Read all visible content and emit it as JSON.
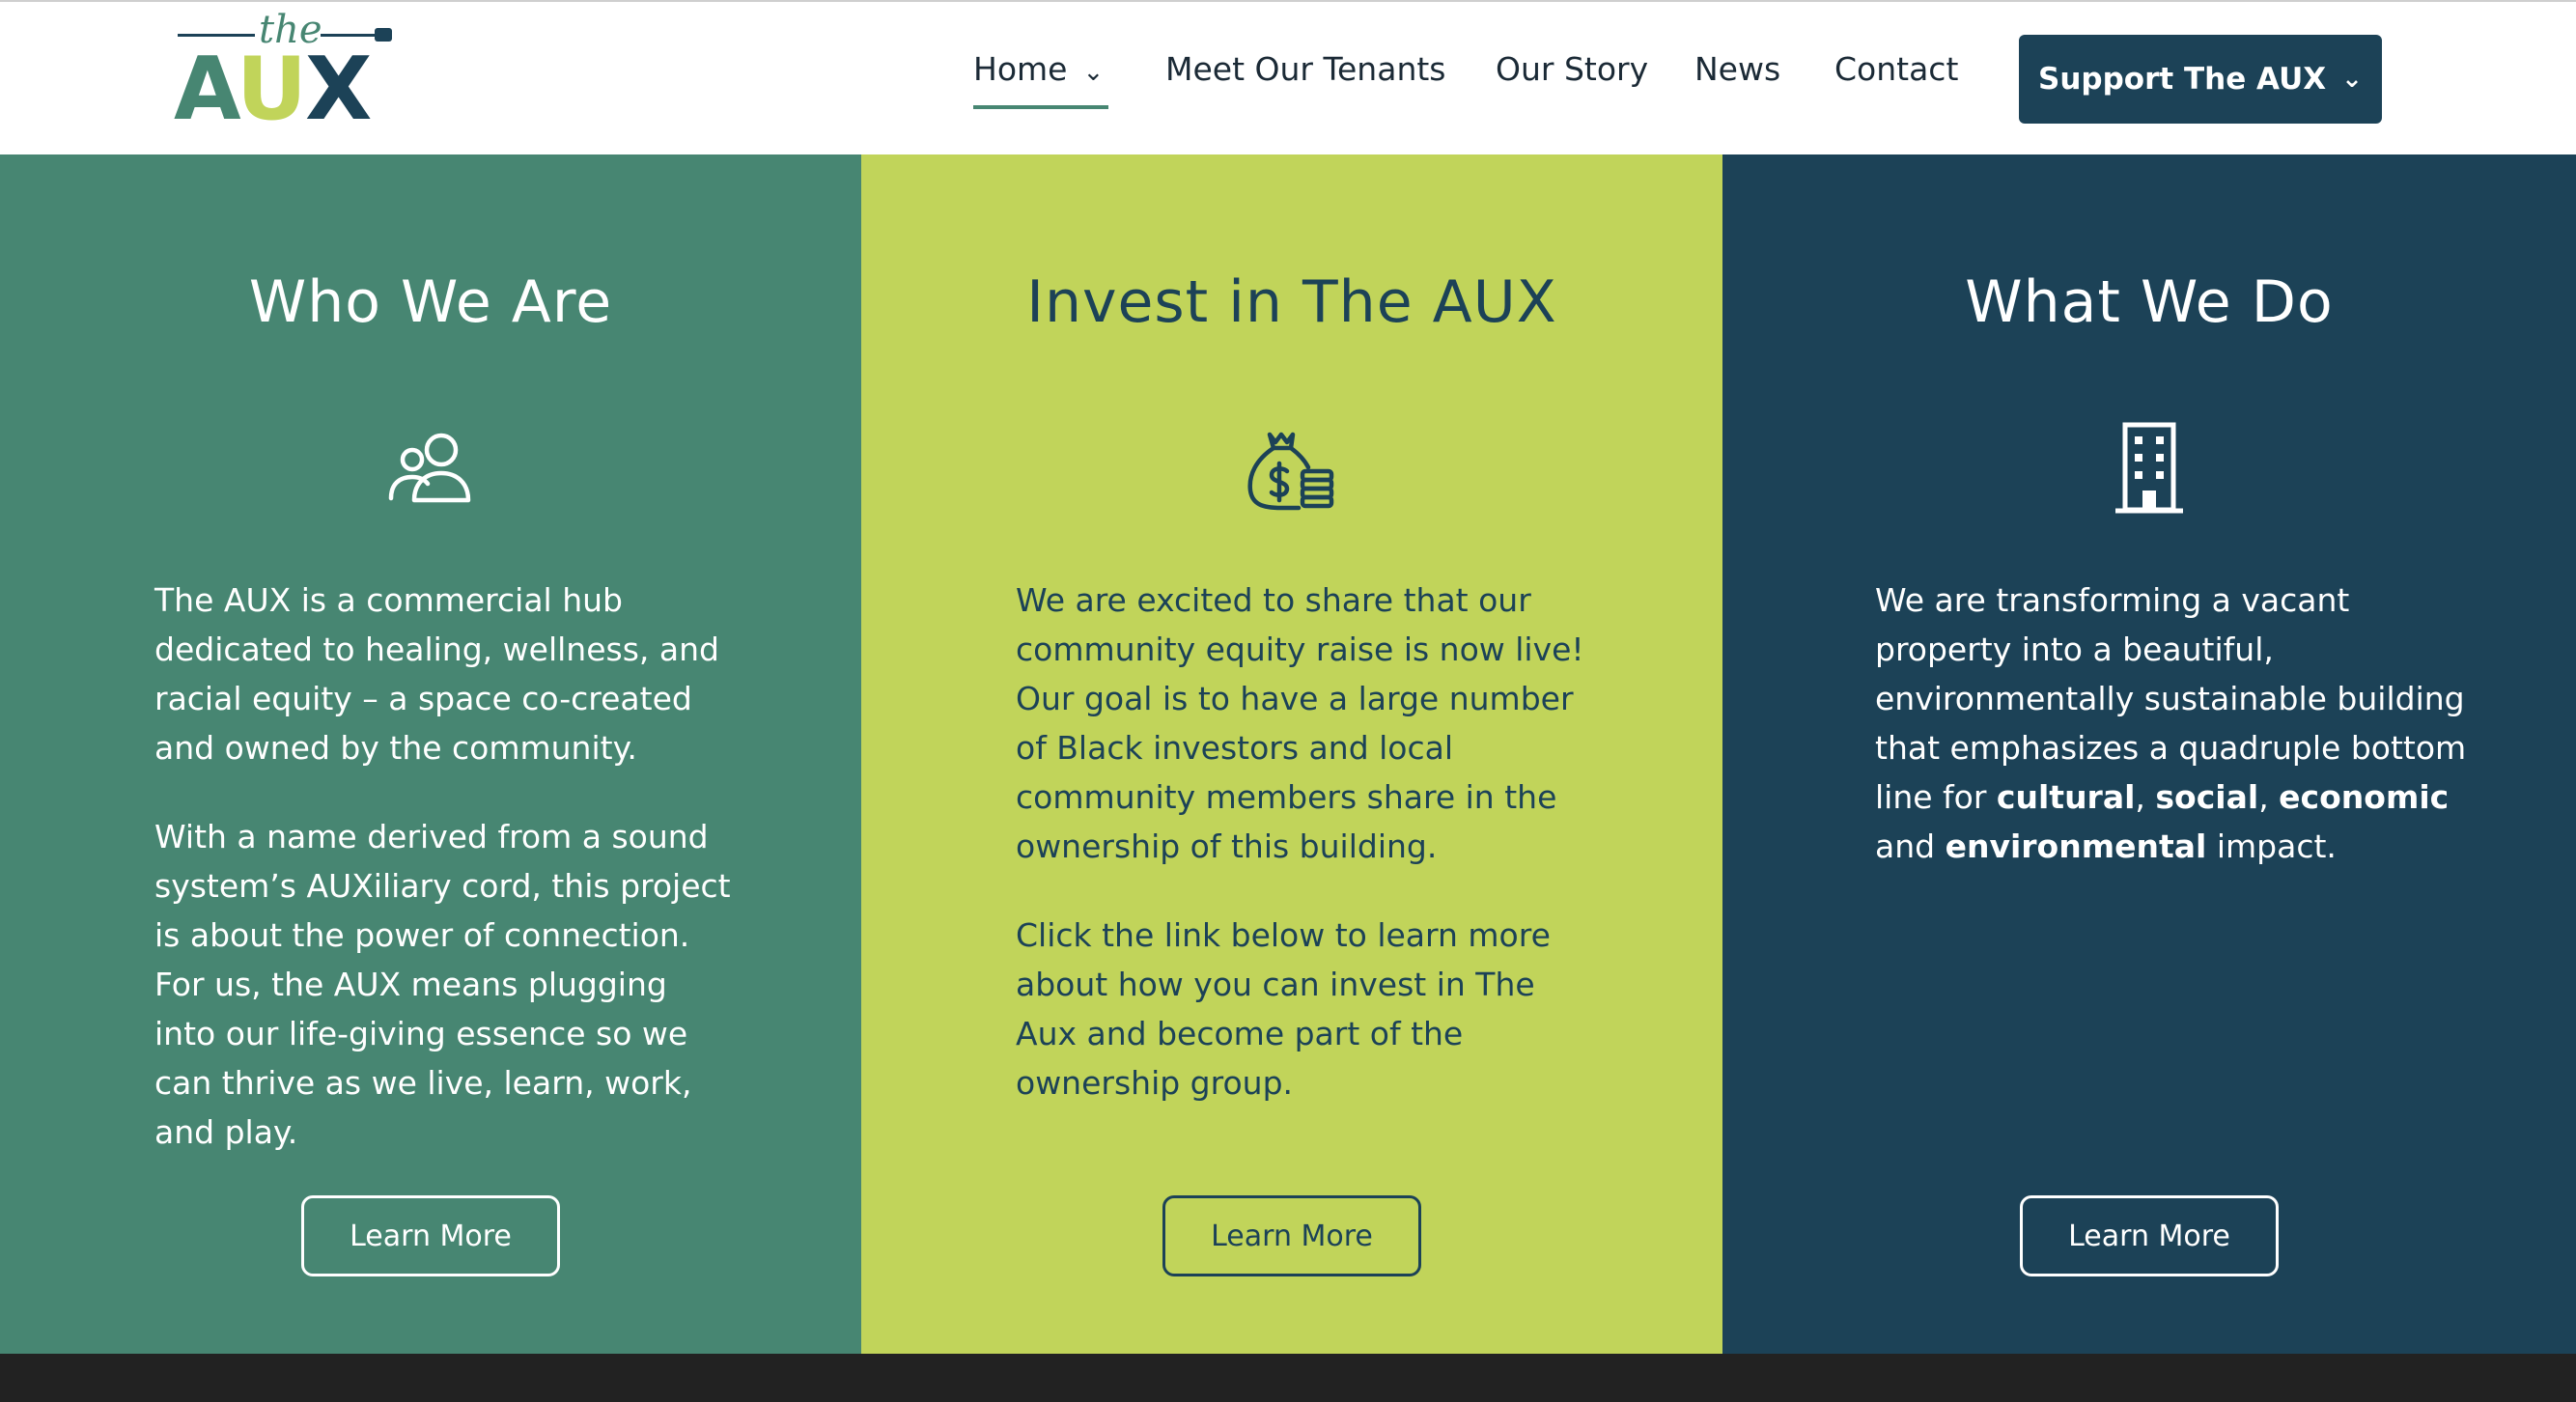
{
  "colors": {
    "green": "#478672",
    "lime": "#c1d45a",
    "navy": "#1c4257",
    "dark": "#222222"
  },
  "logo": {
    "the": "the",
    "a": "A",
    "u": "U",
    "x": "X"
  },
  "nav": {
    "home": "Home",
    "tenants": "Meet Our Tenants",
    "story": "Our Story",
    "news": "News",
    "contact": "Contact",
    "support": "Support The AUX"
  },
  "columns": [
    {
      "title": "Who We Are",
      "icon": "people-icon",
      "paragraphs": [
        "The AUX is a commercial hub dedicated to healing, wellness, and racial equity – a space co-created and owned by the community.",
        "With a name derived from a sound system’s AUXiliary cord, this project is about the power of connection. For us, the AUX means plugging into our life-giving essence so we can thrive as we live, learn, work, and play."
      ],
      "button": "Learn More"
    },
    {
      "title": "Invest in The AUX",
      "icon": "money-bag-icon",
      "paragraphs": [
        "We are excited to share that our community equity raise is now live! Our goal is to have a large number of Black investors and local community members share in the ownership of this building.",
        "Click the link below to learn more about how you can invest in The Aux and become part of the ownership group."
      ],
      "button": "Learn More"
    },
    {
      "title": "What We Do",
      "icon": "building-icon",
      "text_before": "We are transforming a vacant property into a beautiful, environmentally sustainable building that emphasizes a quadruple bottom line for ",
      "bold_1": "cultural",
      "sep_1": ", ",
      "bold_2": "social",
      "sep_2": ", ",
      "bold_3": "economic",
      "sep_3": " and ",
      "bold_4": "environmental",
      "text_after": " impact.",
      "button": "Learn More"
    }
  ]
}
